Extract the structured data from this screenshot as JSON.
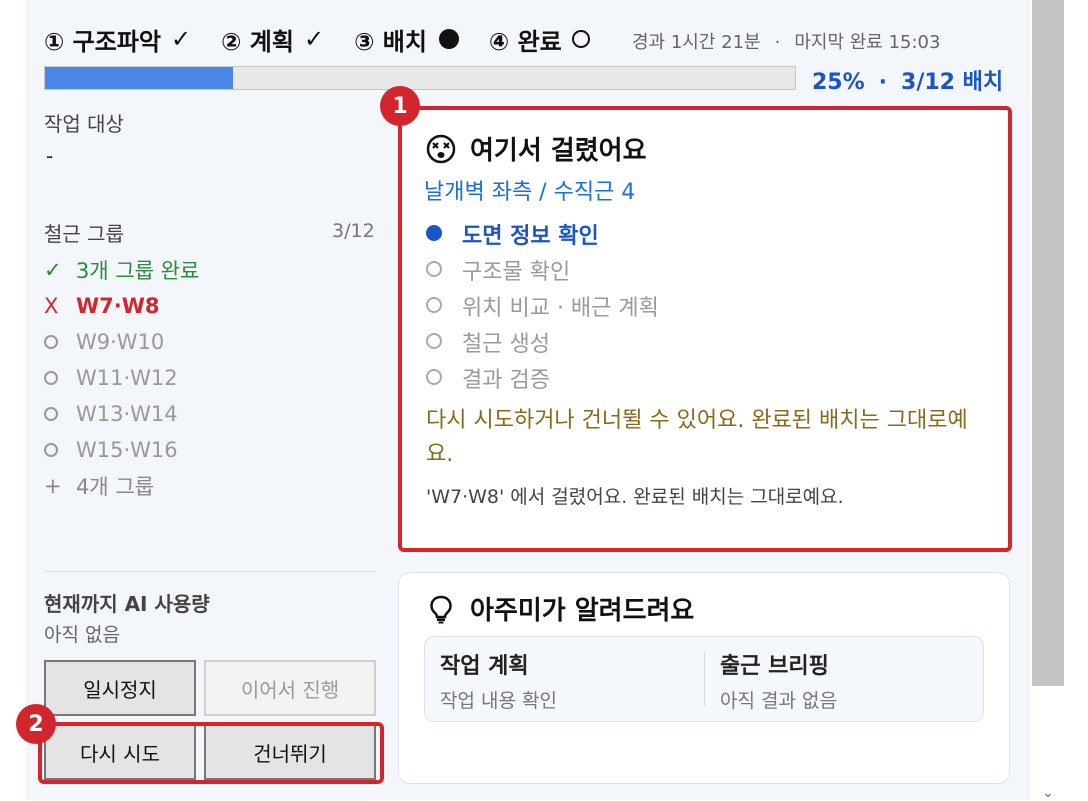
{
  "steps": [
    {
      "label": "① 구조파악",
      "status_icon": "✓"
    },
    {
      "label": "② 계획",
      "status_icon": "✓"
    },
    {
      "label": "③ 배치",
      "status_icon": "filled-dot"
    },
    {
      "label": "④ 완료",
      "status_icon": "open-circle"
    }
  ],
  "meta": {
    "elapsed": "경과 1시간 21분",
    "separator": "·",
    "last_done": "마지막 완료 15:03"
  },
  "progress": {
    "percent_text": "25%",
    "separator": "·",
    "batch_text": "3/12 배치",
    "fraction": 0.25
  },
  "target": {
    "label": "작업 대상",
    "value": "-"
  },
  "groups": {
    "label": "철근 그룹",
    "count": "3/12",
    "items": [
      {
        "icon": "✓",
        "text": "3개 그룹 완료",
        "state": "done"
      },
      {
        "icon": "X",
        "text": "W7·W8",
        "state": "failed"
      },
      {
        "icon": "○",
        "text": "W9·W10",
        "state": "pending"
      },
      {
        "icon": "○",
        "text": "W11·W12",
        "state": "pending"
      },
      {
        "icon": "○",
        "text": "W13·W14",
        "state": "pending"
      },
      {
        "icon": "○",
        "text": "W15·W16",
        "state": "pending"
      },
      {
        "icon": "+",
        "text": "4개 그룹",
        "state": "more"
      }
    ]
  },
  "usage": {
    "label": "현재까지 AI 사용량",
    "value": "아직 없음"
  },
  "buttons": {
    "pause": "일시정지",
    "continue": "이어서 진행",
    "retry": "다시 시도",
    "skip": "건너뛰기"
  },
  "error": {
    "title": "여기서 걸렸어요",
    "location": "날개벽 좌측 / 수직근 4",
    "phases": [
      {
        "text": "도면 정보 확인",
        "active": true
      },
      {
        "text": "구조물 확인",
        "active": false
      },
      {
        "text": "위치 비교 · 배근 계획",
        "active": false
      },
      {
        "text": "철근 생성",
        "active": false
      },
      {
        "text": "결과 검증",
        "active": false
      }
    ],
    "message": "다시 시도하거나 건너뛸 수 있어요. 완료된 배치는 그대로예요.",
    "detail": "'W7·W8' 에서 걸렸어요. 완료된 배치는 그대로예요."
  },
  "tips": {
    "title": "아주미가 알려드려요",
    "items": [
      {
        "title": "작업 계획",
        "subtitle": "작업 내용 확인"
      },
      {
        "title": "출근 브리핑",
        "subtitle": "아직 결과 없음"
      }
    ]
  },
  "annotations": {
    "badge1": "1",
    "badge2": "2"
  },
  "colors": {
    "accent": "#1a55c8",
    "progress": "#4a86e8",
    "error": "#d3252d",
    "success": "#2e8b3a",
    "warning_text": "#8a6a1a"
  }
}
